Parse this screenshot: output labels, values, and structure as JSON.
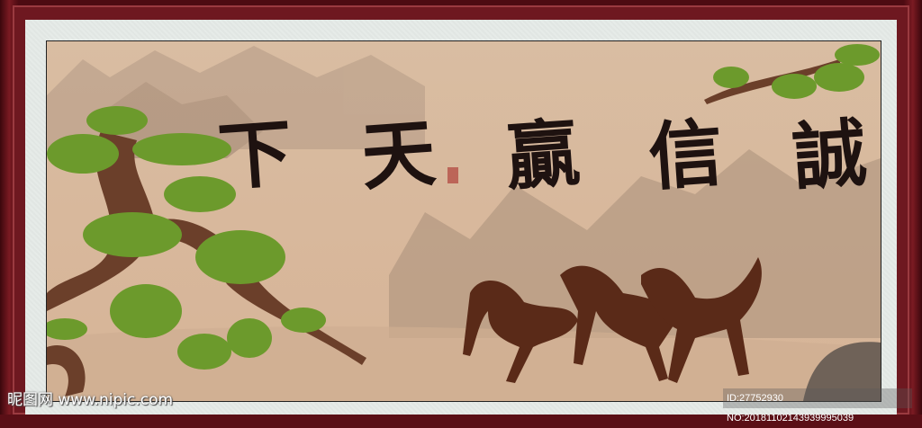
{
  "artwork": {
    "calligraphy": [
      "下",
      "天",
      "贏",
      "信",
      "誠"
    ],
    "description_subjects": [
      "pine-tree",
      "galloping-horses",
      "mountains"
    ]
  },
  "watermark": {
    "site": "昵图网 www.nipic.com",
    "id_text": "ID:27752930 NO:20181102143939995039"
  },
  "colors": {
    "frame": "#5a0f16",
    "matte": "#e6ebe8",
    "paper": "#d8b89c",
    "ink": "#1e1210",
    "pine": "#6c9a2c",
    "horse": "#5a2a18"
  }
}
